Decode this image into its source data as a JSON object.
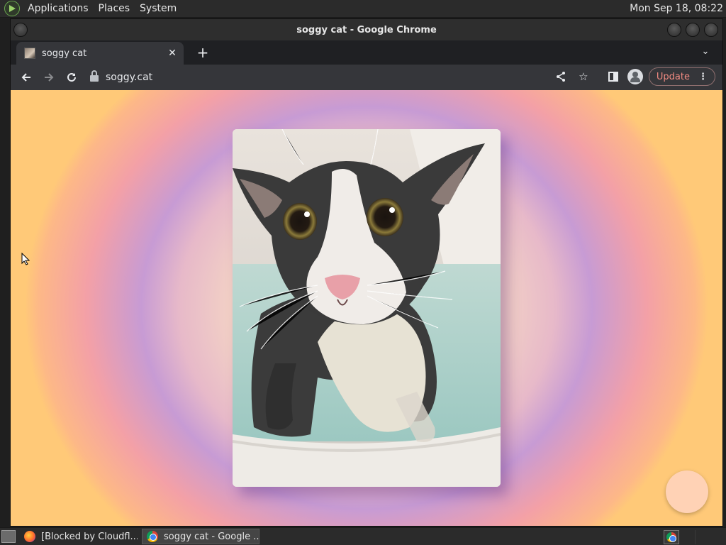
{
  "top_panel": {
    "menus": [
      "Applications",
      "Places",
      "System"
    ],
    "clock": "Mon Sep 18, 08:22"
  },
  "window": {
    "title": "soggy cat - Google Chrome"
  },
  "tabs": [
    {
      "label": "soggy cat",
      "icon": "cat-thumbnail-icon"
    }
  ],
  "toolbar": {
    "url": "soggy.cat",
    "update_label": "Update"
  },
  "page": {
    "image_subject": "wet black and white cat in bathtub"
  },
  "taskbar": {
    "tasks": [
      {
        "label": "[Blocked by Cloudfl...",
        "icon": "firefox-icon"
      },
      {
        "label": "soggy cat - Google ...",
        "icon": "chrome-icon"
      }
    ]
  }
}
